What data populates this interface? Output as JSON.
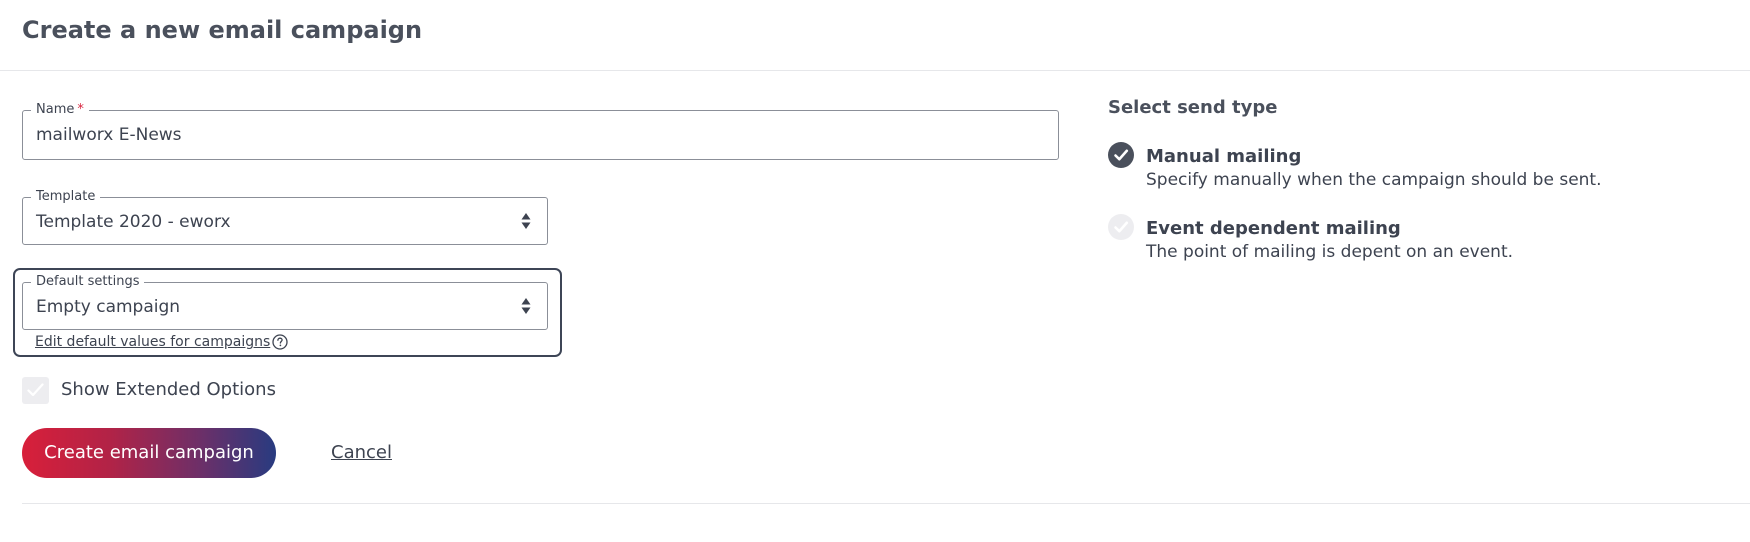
{
  "header": {
    "title": "Create a new email campaign"
  },
  "form": {
    "name": {
      "label": "Name",
      "required_marker": "*",
      "value": "mailworx E-News"
    },
    "template": {
      "label": "Template",
      "selected": "Template 2020 - eworx"
    },
    "default_settings": {
      "label": "Default settings",
      "selected": "Empty campaign",
      "edit_link": "Edit default values for campaigns"
    },
    "extended_options": {
      "label": "Show Extended Options",
      "checked": false
    },
    "actions": {
      "create_label": "Create email campaign",
      "cancel_label": "Cancel"
    }
  },
  "send_type": {
    "title": "Select send type",
    "options": [
      {
        "title": "Manual mailing",
        "description": "Specify manually when the campaign should be sent.",
        "selected": true
      },
      {
        "title": "Event dependent mailing",
        "description": "The point of mailing is depent on an event.",
        "selected": false
      }
    ]
  },
  "colors": {
    "accent_start": "#d81f3a",
    "accent_end": "#283b80",
    "text": "#3d4350",
    "selected_icon": "#4a505c",
    "unselected_icon": "#ededf0"
  },
  "icons": {
    "select_arrows": "chevron-updown-icon",
    "help": "question-circle-icon",
    "check": "check-icon"
  }
}
